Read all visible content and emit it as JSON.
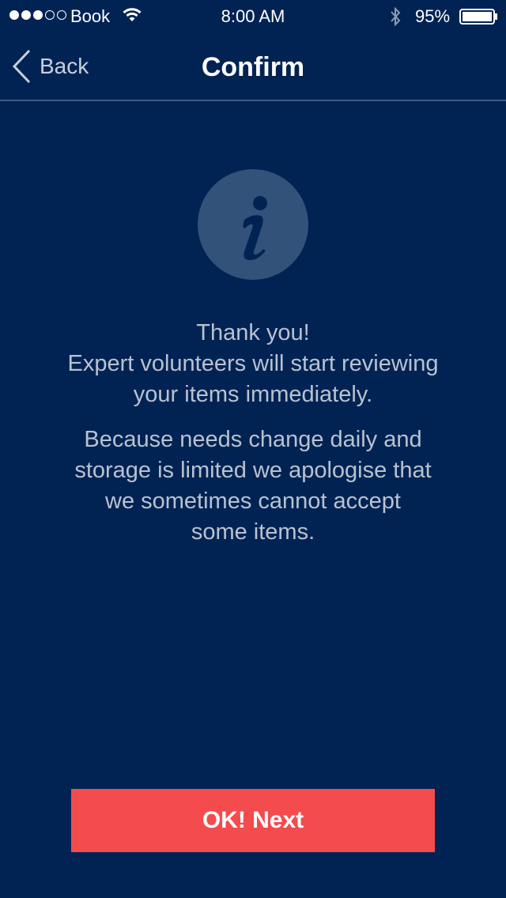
{
  "status_bar": {
    "signal_bars_filled": 3,
    "signal_bars_total": 5,
    "carrier": "Book",
    "time": "8:00 AM",
    "battery_percent": "95%",
    "icons": [
      "signal-dots-icon",
      "wifi-icon",
      "bluetooth-icon",
      "battery-icon"
    ]
  },
  "nav": {
    "back_label": "Back",
    "title": "Confirm"
  },
  "content": {
    "icon": "info-icon",
    "message_lines": [
      "Thank you!",
      "Expert volunteers will start reviewing",
      "your items immediately."
    ],
    "note_lines": [
      "Because needs change daily and",
      "storage is limited we apologise that",
      "we sometimes cannot accept",
      "some items."
    ]
  },
  "actions": {
    "next_label": "OK! Next"
  },
  "colors": {
    "background": "#012353",
    "icon_circle": "#33527a",
    "text_muted": "#b9c2d0",
    "accent_button": "#f44b4f",
    "divider": "#3b5a82"
  }
}
